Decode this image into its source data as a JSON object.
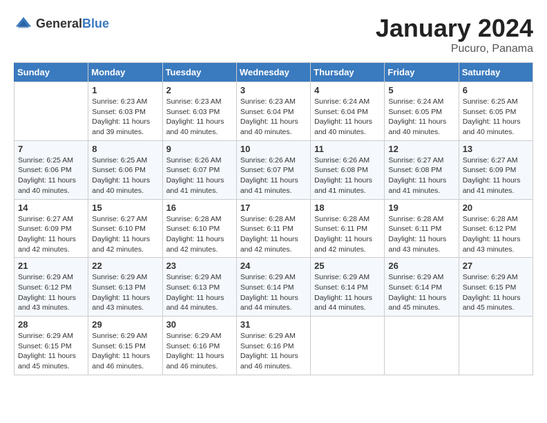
{
  "header": {
    "logo_general": "General",
    "logo_blue": "Blue",
    "month_year": "January 2024",
    "location": "Pucuro, Panama"
  },
  "days_of_week": [
    "Sunday",
    "Monday",
    "Tuesday",
    "Wednesday",
    "Thursday",
    "Friday",
    "Saturday"
  ],
  "weeks": [
    [
      {
        "day": "",
        "sunrise": "",
        "sunset": "",
        "daylight": ""
      },
      {
        "day": "1",
        "sunrise": "Sunrise: 6:23 AM",
        "sunset": "Sunset: 6:03 PM",
        "daylight": "Daylight: 11 hours and 39 minutes."
      },
      {
        "day": "2",
        "sunrise": "Sunrise: 6:23 AM",
        "sunset": "Sunset: 6:03 PM",
        "daylight": "Daylight: 11 hours and 40 minutes."
      },
      {
        "day": "3",
        "sunrise": "Sunrise: 6:23 AM",
        "sunset": "Sunset: 6:04 PM",
        "daylight": "Daylight: 11 hours and 40 minutes."
      },
      {
        "day": "4",
        "sunrise": "Sunrise: 6:24 AM",
        "sunset": "Sunset: 6:04 PM",
        "daylight": "Daylight: 11 hours and 40 minutes."
      },
      {
        "day": "5",
        "sunrise": "Sunrise: 6:24 AM",
        "sunset": "Sunset: 6:05 PM",
        "daylight": "Daylight: 11 hours and 40 minutes."
      },
      {
        "day": "6",
        "sunrise": "Sunrise: 6:25 AM",
        "sunset": "Sunset: 6:05 PM",
        "daylight": "Daylight: 11 hours and 40 minutes."
      }
    ],
    [
      {
        "day": "7",
        "sunrise": "Sunrise: 6:25 AM",
        "sunset": "Sunset: 6:06 PM",
        "daylight": "Daylight: 11 hours and 40 minutes."
      },
      {
        "day": "8",
        "sunrise": "Sunrise: 6:25 AM",
        "sunset": "Sunset: 6:06 PM",
        "daylight": "Daylight: 11 hours and 40 minutes."
      },
      {
        "day": "9",
        "sunrise": "Sunrise: 6:26 AM",
        "sunset": "Sunset: 6:07 PM",
        "daylight": "Daylight: 11 hours and 41 minutes."
      },
      {
        "day": "10",
        "sunrise": "Sunrise: 6:26 AM",
        "sunset": "Sunset: 6:07 PM",
        "daylight": "Daylight: 11 hours and 41 minutes."
      },
      {
        "day": "11",
        "sunrise": "Sunrise: 6:26 AM",
        "sunset": "Sunset: 6:08 PM",
        "daylight": "Daylight: 11 hours and 41 minutes."
      },
      {
        "day": "12",
        "sunrise": "Sunrise: 6:27 AM",
        "sunset": "Sunset: 6:08 PM",
        "daylight": "Daylight: 11 hours and 41 minutes."
      },
      {
        "day": "13",
        "sunrise": "Sunrise: 6:27 AM",
        "sunset": "Sunset: 6:09 PM",
        "daylight": "Daylight: 11 hours and 41 minutes."
      }
    ],
    [
      {
        "day": "14",
        "sunrise": "Sunrise: 6:27 AM",
        "sunset": "Sunset: 6:09 PM",
        "daylight": "Daylight: 11 hours and 42 minutes."
      },
      {
        "day": "15",
        "sunrise": "Sunrise: 6:27 AM",
        "sunset": "Sunset: 6:10 PM",
        "daylight": "Daylight: 11 hours and 42 minutes."
      },
      {
        "day": "16",
        "sunrise": "Sunrise: 6:28 AM",
        "sunset": "Sunset: 6:10 PM",
        "daylight": "Daylight: 11 hours and 42 minutes."
      },
      {
        "day": "17",
        "sunrise": "Sunrise: 6:28 AM",
        "sunset": "Sunset: 6:11 PM",
        "daylight": "Daylight: 11 hours and 42 minutes."
      },
      {
        "day": "18",
        "sunrise": "Sunrise: 6:28 AM",
        "sunset": "Sunset: 6:11 PM",
        "daylight": "Daylight: 11 hours and 42 minutes."
      },
      {
        "day": "19",
        "sunrise": "Sunrise: 6:28 AM",
        "sunset": "Sunset: 6:11 PM",
        "daylight": "Daylight: 11 hours and 43 minutes."
      },
      {
        "day": "20",
        "sunrise": "Sunrise: 6:28 AM",
        "sunset": "Sunset: 6:12 PM",
        "daylight": "Daylight: 11 hours and 43 minutes."
      }
    ],
    [
      {
        "day": "21",
        "sunrise": "Sunrise: 6:29 AM",
        "sunset": "Sunset: 6:12 PM",
        "daylight": "Daylight: 11 hours and 43 minutes."
      },
      {
        "day": "22",
        "sunrise": "Sunrise: 6:29 AM",
        "sunset": "Sunset: 6:13 PM",
        "daylight": "Daylight: 11 hours and 43 minutes."
      },
      {
        "day": "23",
        "sunrise": "Sunrise: 6:29 AM",
        "sunset": "Sunset: 6:13 PM",
        "daylight": "Daylight: 11 hours and 44 minutes."
      },
      {
        "day": "24",
        "sunrise": "Sunrise: 6:29 AM",
        "sunset": "Sunset: 6:14 PM",
        "daylight": "Daylight: 11 hours and 44 minutes."
      },
      {
        "day": "25",
        "sunrise": "Sunrise: 6:29 AM",
        "sunset": "Sunset: 6:14 PM",
        "daylight": "Daylight: 11 hours and 44 minutes."
      },
      {
        "day": "26",
        "sunrise": "Sunrise: 6:29 AM",
        "sunset": "Sunset: 6:14 PM",
        "daylight": "Daylight: 11 hours and 45 minutes."
      },
      {
        "day": "27",
        "sunrise": "Sunrise: 6:29 AM",
        "sunset": "Sunset: 6:15 PM",
        "daylight": "Daylight: 11 hours and 45 minutes."
      }
    ],
    [
      {
        "day": "28",
        "sunrise": "Sunrise: 6:29 AM",
        "sunset": "Sunset: 6:15 PM",
        "daylight": "Daylight: 11 hours and 45 minutes."
      },
      {
        "day": "29",
        "sunrise": "Sunrise: 6:29 AM",
        "sunset": "Sunset: 6:15 PM",
        "daylight": "Daylight: 11 hours and 46 minutes."
      },
      {
        "day": "30",
        "sunrise": "Sunrise: 6:29 AM",
        "sunset": "Sunset: 6:16 PM",
        "daylight": "Daylight: 11 hours and 46 minutes."
      },
      {
        "day": "31",
        "sunrise": "Sunrise: 6:29 AM",
        "sunset": "Sunset: 6:16 PM",
        "daylight": "Daylight: 11 hours and 46 minutes."
      },
      {
        "day": "",
        "sunrise": "",
        "sunset": "",
        "daylight": ""
      },
      {
        "day": "",
        "sunrise": "",
        "sunset": "",
        "daylight": ""
      },
      {
        "day": "",
        "sunrise": "",
        "sunset": "",
        "daylight": ""
      }
    ]
  ]
}
